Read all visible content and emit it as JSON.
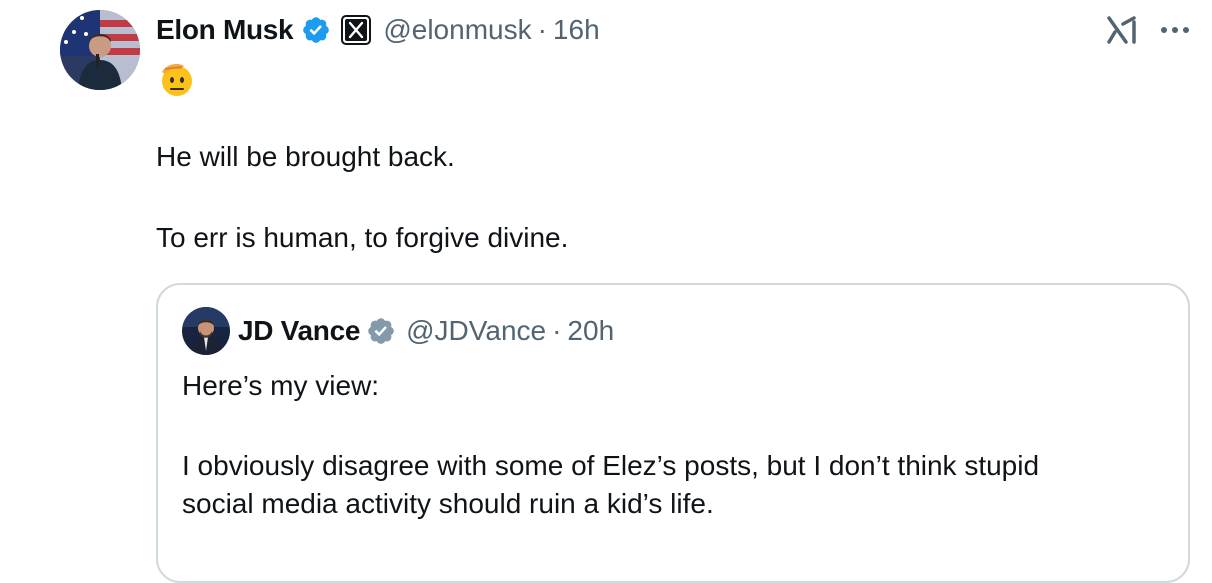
{
  "tweet": {
    "author_name": "Elon Musk",
    "handle": "@elonmusk",
    "separator": "·",
    "time": "16h",
    "status_emoji": "🫡",
    "body_lines": [
      "He will be brought back.",
      "To err is human, to forgive divine."
    ],
    "icons": {
      "verified": "verified-badge-icon",
      "affiliation": "x-logo-icon",
      "grok": "grok-icon",
      "more": "more-options-icon"
    },
    "colors": {
      "verified": "#1d9bf0",
      "secondary_text": "#536471",
      "border": "#cfd9de"
    }
  },
  "quote": {
    "author_name": "JD Vance",
    "handle": "@JDVance",
    "separator": "·",
    "time": "20h",
    "line1": "Here’s my view:",
    "line2": "I obviously disagree with some of Elez’s posts, but I don’t think stupid",
    "line3": "social media activity should ruin a kid’s life.",
    "icons": {
      "verified": "gray-verified-badge-icon"
    },
    "colors": {
      "verified": "#829aab"
    }
  }
}
